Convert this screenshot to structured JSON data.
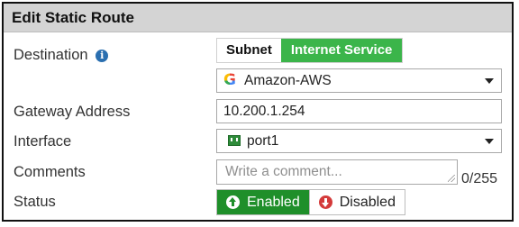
{
  "dialog": {
    "title": "Edit Static Route"
  },
  "destination": {
    "label": "Destination",
    "info_icon": "i",
    "modes": [
      "Subnet",
      "Internet Service"
    ],
    "selected_mode": "Internet Service",
    "service_value": "Amazon-AWS",
    "service_icon": "G"
  },
  "gateway": {
    "label": "Gateway Address",
    "value": "10.200.1.254"
  },
  "interface": {
    "label": "Interface",
    "value": "port1",
    "icon": "port-icon"
  },
  "comments": {
    "label": "Comments",
    "placeholder": "Write a comment...",
    "counter": "0/255"
  },
  "status": {
    "label": "Status",
    "enabled_label": "Enabled",
    "disabled_label": "Disabled",
    "selected": "Enabled"
  },
  "colors": {
    "internet_service_active": "#3bb54a",
    "enabled_active": "#1f8f2a",
    "disabled_icon": "#d43a3a",
    "header_bg": "#d4d4d4"
  }
}
